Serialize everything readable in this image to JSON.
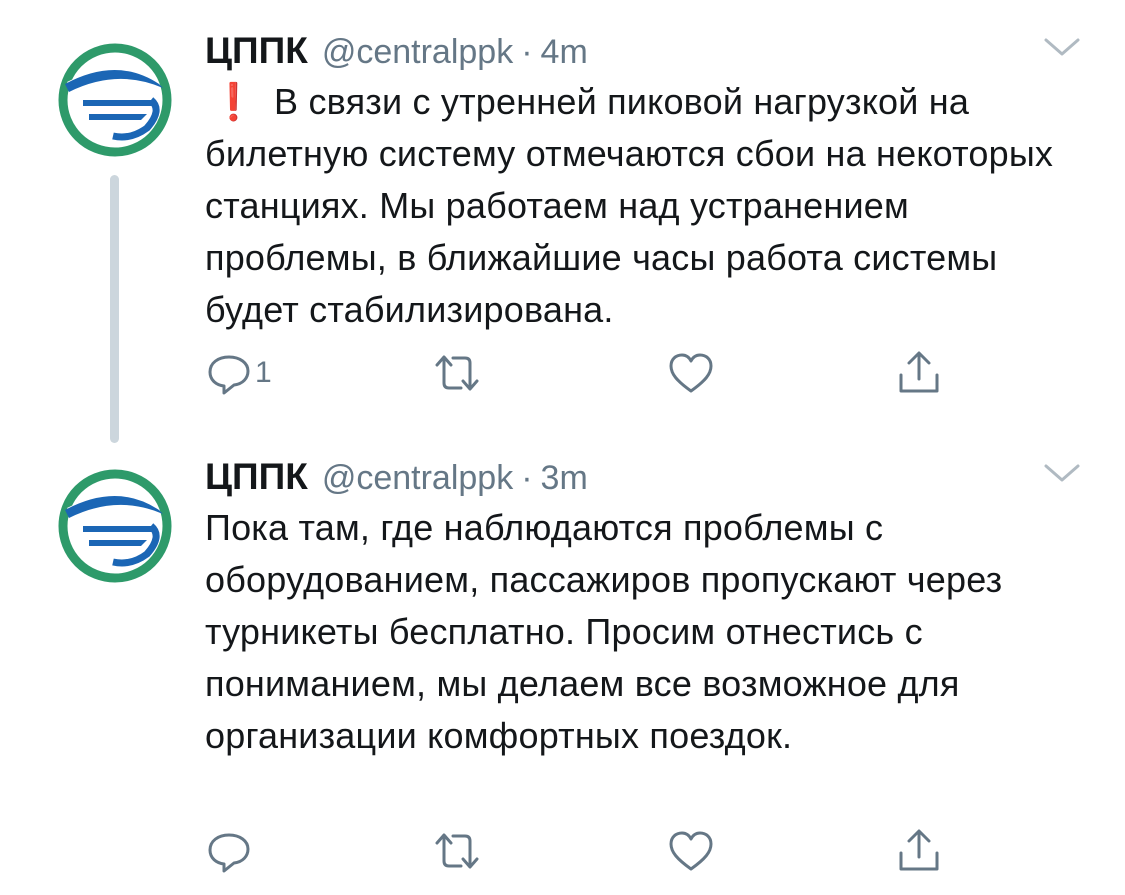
{
  "tweets": [
    {
      "name": "ЦППК",
      "handle": "@centralppk",
      "separator": "·",
      "time": "4m",
      "emoji": "❗",
      "text": "В связи с утренней пиковой нагрузкой на билетную систему отмечаются сбои на некоторых станциях. Мы работаем над устранением проблемы, в ближайшие часы работа системы будет стабилизирована.",
      "reply_count": "1"
    },
    {
      "name": "ЦППК",
      "handle": "@centralppk",
      "separator": "·",
      "time": "3m",
      "text": "Пока там, где наблюдаются проблемы с оборудованием, пассажиров пропускают через турникеты бесплатно. Просим отнестись с пониманием, мы делаем все возможное для организации комфортных поездок.",
      "reply_count": ""
    }
  ],
  "colors": {
    "avatar_green": "#2e9a6a",
    "avatar_blue": "#1b66b5",
    "icon_gray": "#657786",
    "thread_line": "#ccd6dd",
    "exclaim_red": "#e0242f"
  },
  "icons": [
    "reply-icon",
    "retweet-icon",
    "like-icon",
    "share-icon",
    "chevron-down-icon"
  ]
}
